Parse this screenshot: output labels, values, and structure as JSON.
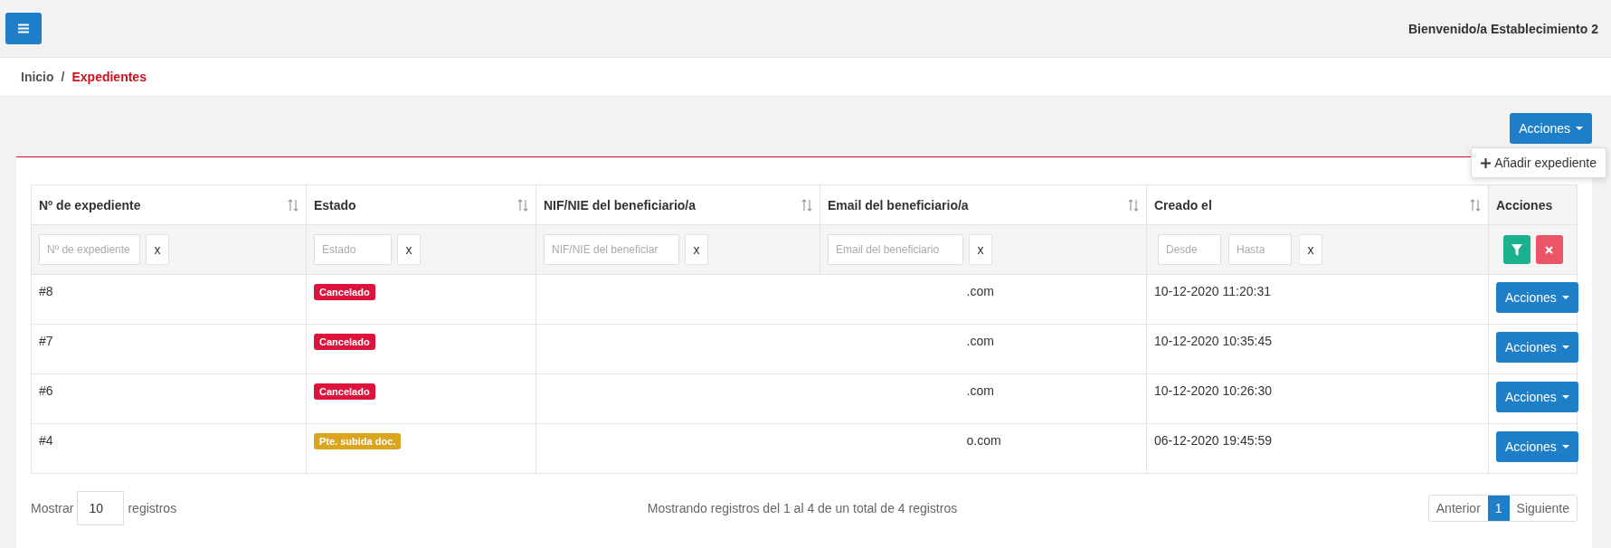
{
  "topbar": {
    "welcome": "Bienvenido/a Establecimiento 2"
  },
  "breadcrumb_separator": "/",
  "breadcrumb": [
    {
      "label": "Inicio",
      "selected": false
    },
    {
      "label": "Expedientes",
      "selected": true
    }
  ],
  "actions_button": {
    "label": "Acciones"
  },
  "actions_menu": {
    "expanded": true,
    "items": [
      {
        "label": "Añadir expediente"
      }
    ]
  },
  "table": {
    "columns": [
      {
        "label": "Nº de expediente",
        "sortable": true,
        "filters": [
          {
            "placeholder": "Nº de expediente"
          }
        ],
        "clear": "x"
      },
      {
        "label": "Estado",
        "sortable": true,
        "filters": [
          {
            "placeholder": "Estado"
          }
        ],
        "clear": "x"
      },
      {
        "label": "NIF/NIE del beneficiario/a",
        "sortable": true,
        "filters": [
          {
            "placeholder": "NIF/NIE del beneficiar"
          }
        ],
        "clear": "x"
      },
      {
        "label": "Email del beneficiario/a",
        "sortable": true,
        "filters": [
          {
            "placeholder": "Email del beneficiario"
          }
        ],
        "clear": "x"
      },
      {
        "label": "Creado el",
        "sortable": true,
        "filters": [
          {
            "placeholder": "Desde"
          },
          {
            "placeholder": "Hasta"
          }
        ],
        "clear": "x"
      },
      {
        "label": "Acciones",
        "sortable": false
      }
    ],
    "rows": [
      {
        "number": "#8",
        "status": {
          "label": "Cancelado",
          "color": "#dc143c"
        },
        "email": ".com",
        "created": "10-12-2020 11:20:31",
        "action": "Acciones"
      },
      {
        "number": "#7",
        "status": {
          "label": "Cancelado",
          "color": "#dc143c"
        },
        "email": ".com",
        "created": "10-12-2020 10:35:45",
        "action": "Acciones"
      },
      {
        "number": "#6",
        "status": {
          "label": "Cancelado",
          "color": "#dc143c"
        },
        "email": ".com",
        "created": "10-12-2020 10:26:30",
        "action": "Acciones"
      },
      {
        "number": "#4",
        "status": {
          "label": "Pte. subida doc.",
          "color": "#daa520"
        },
        "email": "o.com",
        "created": "06-12-2020 19:45:59",
        "action": "Acciones"
      }
    ]
  },
  "footer": {
    "show_label": "Mostrar",
    "page_size": "10",
    "records_label": "registros",
    "info": "Mostrando registros del 1 al 4 de un total de 4 registros",
    "pagination": [
      {
        "label": "Anterior",
        "selected": false
      },
      {
        "label": "1",
        "selected": true
      },
      {
        "label": "Siguiente",
        "selected": false
      }
    ]
  }
}
